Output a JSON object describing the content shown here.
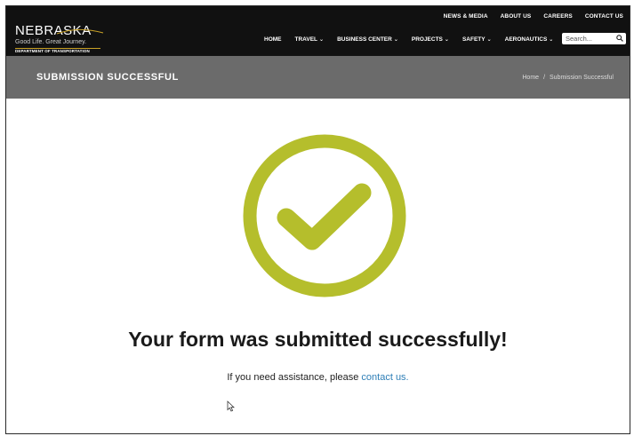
{
  "utility_nav": [
    {
      "label": "NEWS & MEDIA"
    },
    {
      "label": "ABOUT US"
    },
    {
      "label": "CAREERS"
    },
    {
      "label": "CONTACT US"
    }
  ],
  "logo": {
    "title": "NEBRASKA",
    "tagline": "Good Life. Great Journey.",
    "department": "DEPARTMENT OF TRANSPORTATION",
    "accent_color": "#c9a227"
  },
  "main_nav": [
    {
      "label": "HOME",
      "has_dropdown": false
    },
    {
      "label": "TRAVEL",
      "has_dropdown": true
    },
    {
      "label": "BUSINESS CENTER",
      "has_dropdown": true
    },
    {
      "label": "PROJECTS",
      "has_dropdown": true
    },
    {
      "label": "SAFETY",
      "has_dropdown": true
    },
    {
      "label": "AERONAUTICS",
      "has_dropdown": true
    }
  ],
  "search": {
    "placeholder": "Search...",
    "value": "",
    "icon": "search-icon"
  },
  "page_header": {
    "title": "SUBMISSION SUCCESSFUL",
    "breadcrumb": {
      "home": "Home",
      "separator": "/",
      "current": "Submission Successful"
    }
  },
  "success": {
    "icon": "check-circle-icon",
    "icon_color": "#b5be2c",
    "heading": "Your form was submitted successfully!",
    "assist_prefix": "If you need assistance, please",
    "contact_link": "contact us."
  },
  "colors": {
    "header_bg": "#111111",
    "title_band_bg": "#6b6b6b",
    "link": "#2f7fb7"
  }
}
